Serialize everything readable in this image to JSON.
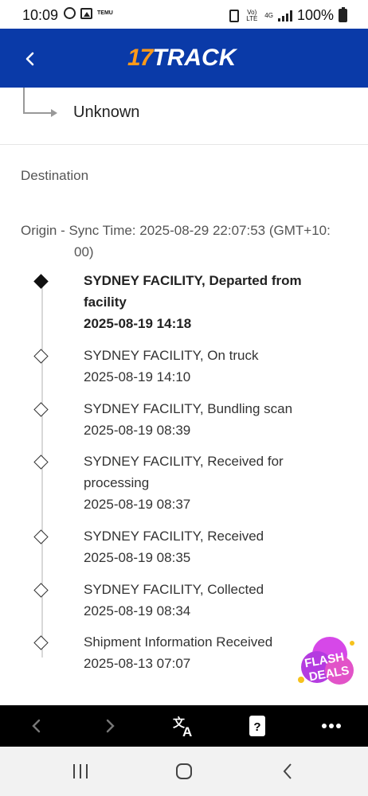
{
  "status_bar": {
    "time": "10:09",
    "temu_label": "TEMU",
    "volte_label": "Vo) LTE",
    "network_label": "4G",
    "battery": "100%"
  },
  "header": {
    "logo_number": "17",
    "logo_text": "TRACK",
    "background_color": "#0a3aa8",
    "accent_color": "#ff9a1a"
  },
  "carrier": {
    "unknown_label": "Unknown"
  },
  "destination": {
    "label": "Destination"
  },
  "origin": {
    "sync_line1": "Origin - Sync Time: 2025-08-29 22:07:53 (GMT+10:",
    "sync_line2": "00)"
  },
  "events": [
    {
      "description": "SYDNEY FACILITY, Departed from facility",
      "time": "2025-08-19 14:18",
      "current": true
    },
    {
      "description": "SYDNEY FACILITY, On truck",
      "time": "2025-08-19 14:10",
      "current": false
    },
    {
      "description": "SYDNEY FACILITY, Bundling scan",
      "time": "2025-08-19 08:39",
      "current": false
    },
    {
      "description": "SYDNEY FACILITY, Received for processing",
      "time": "2025-08-19 08:37",
      "current": false
    },
    {
      "description": "SYDNEY FACILITY, Received",
      "time": "2025-08-19 08:35",
      "current": false
    },
    {
      "description": "SYDNEY FACILITY, Collected",
      "time": "2025-08-19 08:34",
      "current": false
    },
    {
      "description": "Shipment Information Received",
      "time": "2025-08-13 07:07",
      "current": false
    }
  ],
  "promo": {
    "line1": "FLASH",
    "line2": "DEALS"
  },
  "browser_toolbar": {
    "icons": [
      "back-icon",
      "forward-icon",
      "translate-icon",
      "help-card-icon",
      "more-icon"
    ]
  },
  "nav_bar": {
    "icons": [
      "recent-apps-icon",
      "home-icon",
      "back-icon"
    ]
  }
}
